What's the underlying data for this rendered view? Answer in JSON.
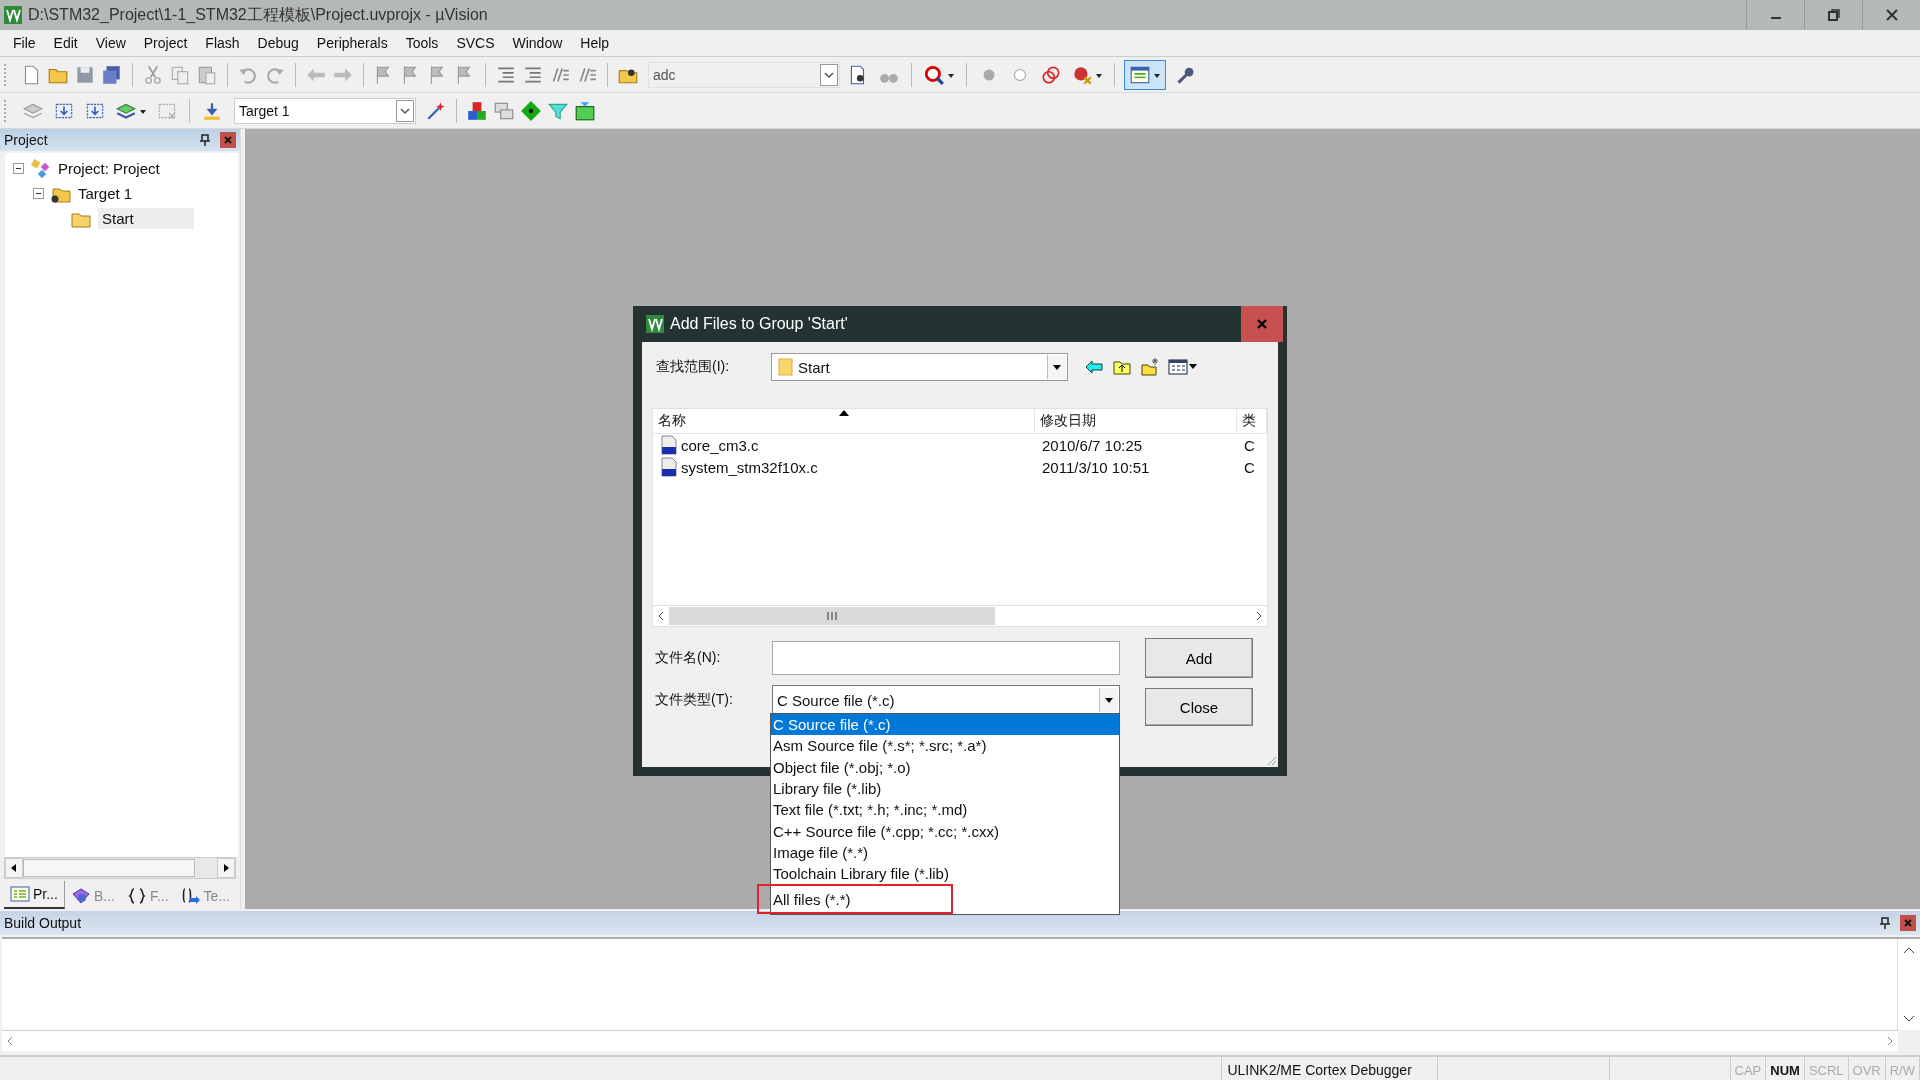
{
  "window": {
    "title": "D:\\STM32_Project\\1-1_STM32工程模板\\Project.uvprojx - µVision"
  },
  "menu": [
    "File",
    "Edit",
    "View",
    "Project",
    "Flash",
    "Debug",
    "Peripherals",
    "Tools",
    "SVCS",
    "Window",
    "Help"
  ],
  "toolbar": {
    "find_combo": "adc",
    "target_combo": "Target 1"
  },
  "project_panel": {
    "title": "Project",
    "tree": [
      {
        "label": "Project: Project",
        "kind": "project",
        "expanded": true,
        "selected": false,
        "children": [
          {
            "label": "Target 1",
            "kind": "target",
            "expanded": true,
            "selected": false,
            "children": [
              {
                "label": "Start",
                "kind": "group",
                "selected": true
              }
            ]
          }
        ]
      }
    ],
    "tabs": [
      {
        "label": "Pr...",
        "kind": "project",
        "selected": true
      },
      {
        "label": "B...",
        "kind": "books",
        "selected": false
      },
      {
        "label": "F...",
        "kind": "functions",
        "selected": false
      },
      {
        "label": "Te...",
        "kind": "templates",
        "selected": false
      }
    ]
  },
  "dialog": {
    "title": "Add Files to Group 'Start'",
    "look_in_label": "查找范围(I):",
    "look_in": "Start",
    "columns": [
      {
        "label": "名称",
        "sorted": true
      },
      {
        "label": "修改日期",
        "sorted": false
      },
      {
        "label": "类",
        "sorted": false
      }
    ],
    "files": [
      {
        "name": "core_cm3.c",
        "date": "2010/6/7 10:25",
        "type": "C"
      },
      {
        "name": "system_stm32f10x.c",
        "date": "2011/3/10 10:51",
        "type": "C"
      }
    ],
    "filename_label": "文件名(N):",
    "filetype_label": "文件类型(T):",
    "filetype": "C Source file (*.c)",
    "filetype_options": [
      {
        "label": "C Source file (*.c)",
        "selected": true,
        "annotated": false
      },
      {
        "label": "Asm Source file (*.s*; *.src; *.a*)",
        "selected": false,
        "annotated": false
      },
      {
        "label": "Object file (*.obj; *.o)",
        "selected": false,
        "annotated": false
      },
      {
        "label": "Library file (*.lib)",
        "selected": false,
        "annotated": false
      },
      {
        "label": "Text file (*.txt; *.h; *.inc; *.md)",
        "selected": false,
        "annotated": false
      },
      {
        "label": "C++ Source file (*.cpp; *.cc; *.cxx)",
        "selected": false,
        "annotated": false
      },
      {
        "label": "Image file (*.*)",
        "selected": false,
        "annotated": false
      },
      {
        "label": "Toolchain Library file (*.lib)",
        "selected": false,
        "annotated": false
      },
      {
        "label": "All files (*.*)",
        "selected": false,
        "annotated": true
      }
    ],
    "buttons": [
      "Add",
      "Close"
    ]
  },
  "build_output": {
    "title": "Build Output"
  },
  "status_bar": {
    "debugger": "ULINK2/ME Cortex Debugger",
    "indicators": [
      {
        "label": "CAP",
        "on": false
      },
      {
        "label": "NUM",
        "on": true
      },
      {
        "label": "SCRL",
        "on": false
      },
      {
        "label": "OVR",
        "on": false
      },
      {
        "label": "R/W",
        "on": false
      }
    ]
  }
}
